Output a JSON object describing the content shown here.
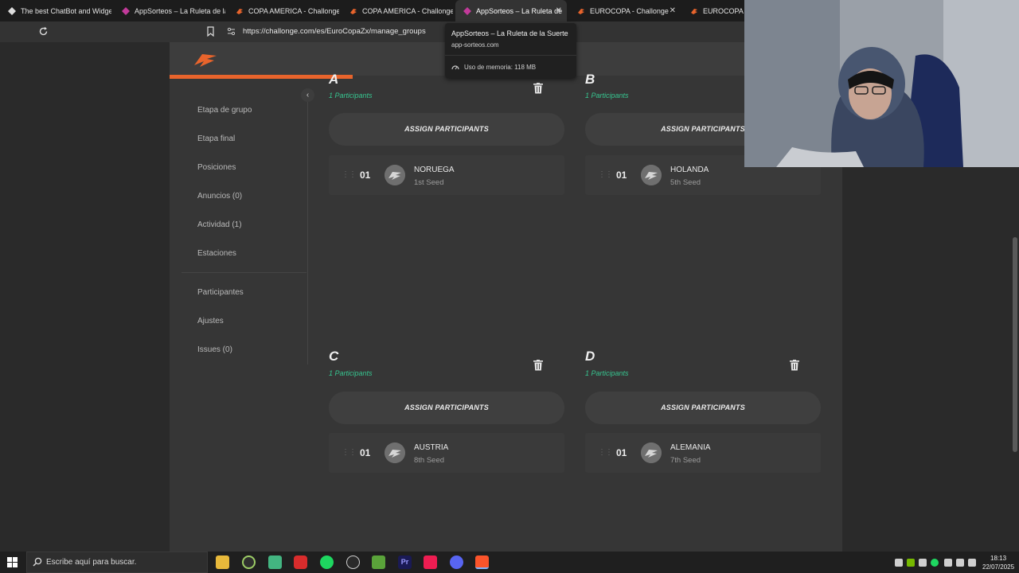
{
  "tabs": [
    {
      "title": "The best ChatBot and Widgets"
    },
    {
      "title": "AppSorteos – La Ruleta de la S"
    },
    {
      "title": "COPA AMERICA - Challonge"
    },
    {
      "title": "COPA AMERICA - Challonge"
    },
    {
      "title": "AppSorteos – La Ruleta de"
    },
    {
      "title": "EUROCOPA - Challonge"
    },
    {
      "title": "EUROCOPA - Ch"
    }
  ],
  "address_bar": {
    "url": "https://challonge.com/es/EuroCopaZx/manage_groups"
  },
  "tooltip": {
    "title": "AppSorteos – La Ruleta de la Suerte",
    "domain": "app-sorteos.com",
    "memory": "Uso de memoria: 118 MB"
  },
  "sidebar": {
    "items": [
      {
        "label": "Etapa de grupo"
      },
      {
        "label": "Etapa final"
      },
      {
        "label": "Posiciones"
      },
      {
        "label": "Anuncios (0)"
      },
      {
        "label": "Actividad (1)"
      },
      {
        "label": "Estaciones"
      },
      {
        "label": "Participantes"
      },
      {
        "label": "Ajustes"
      },
      {
        "label": "Issues (0)"
      }
    ]
  },
  "groups": [
    {
      "letter": "A",
      "count": "1 Participants",
      "assign_label": "ASSIGN PARTICIPANTS",
      "participants": [
        {
          "num": "01",
          "name": "NORUEGA",
          "seed": "1st Seed"
        }
      ]
    },
    {
      "letter": "B",
      "count": "1 Participants",
      "assign_label": "ASSIGN PARTICIPANTS",
      "participants": [
        {
          "num": "01",
          "name": "HOLANDA",
          "seed": "5th Seed"
        }
      ]
    },
    {
      "letter": "C",
      "count": "1 Participants",
      "assign_label": "ASSIGN PARTICIPANTS",
      "participants": [
        {
          "num": "01",
          "name": "AUSTRIA",
          "seed": "8th Seed"
        }
      ]
    },
    {
      "letter": "D",
      "count": "1 Participants",
      "assign_label": "ASSIGN PARTICIPANTS",
      "participants": [
        {
          "num": "01",
          "name": "ALEMANIA",
          "seed": "7th Seed"
        }
      ]
    }
  ],
  "taskbar": {
    "search_placeholder": "Escribe aquí para buscar.",
    "time": "18:13",
    "date": "22/07/2025"
  },
  "colors": {
    "accent": "#e8642c",
    "count_green": "#36c48f"
  }
}
